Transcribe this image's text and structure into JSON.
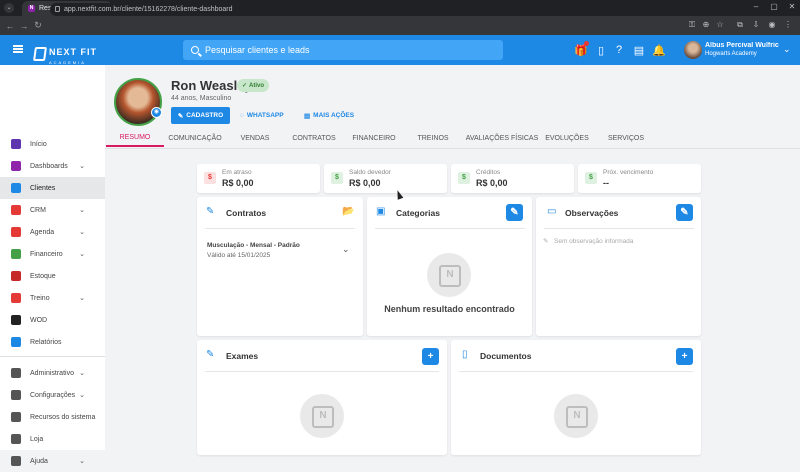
{
  "browser": {
    "tab_title": "Resumo - Next Fit",
    "tab_favicon": "N",
    "url": "app.nextfit.com.br/cliente/15162278/cliente-dashboard"
  },
  "header": {
    "logo_text": "NEXT FIT",
    "logo_sub": "ACADEMIA",
    "search_placeholder": "Pesquisar clientes e leads",
    "user_name": "Albus Percival Wulfric B...",
    "user_org": "Hogwarts Academy",
    "accent": "#1e88e5"
  },
  "sidebar": {
    "items": [
      {
        "label": "Início",
        "icon": "home-icon",
        "color": "#5e35b1"
      },
      {
        "label": "Dashboards",
        "icon": "chart-icon",
        "color": "#8e24aa"
      },
      {
        "label": "Clientes",
        "icon": "people-icon",
        "color": "#1e88e5"
      },
      {
        "label": "CRM",
        "icon": "crm-icon",
        "color": "#e53935"
      },
      {
        "label": "Agenda",
        "icon": "calendar-icon",
        "color": "#e53935"
      },
      {
        "label": "Financeiro",
        "icon": "money-icon",
        "color": "#43a047"
      },
      {
        "label": "Estoque",
        "icon": "cart-icon",
        "color": "#c62828"
      },
      {
        "label": "Treino",
        "icon": "dumbbell-icon",
        "color": "#e53935"
      },
      {
        "label": "WOD",
        "icon": "kettlebell-icon",
        "color": "#222222"
      },
      {
        "label": "Relatórios",
        "icon": "report-icon",
        "color": "#1e88e5"
      },
      {
        "label": "Administrativo",
        "icon": "admin-icon",
        "color": "#555555"
      },
      {
        "label": "Configurações",
        "icon": "gear-icon",
        "color": "#555555"
      },
      {
        "label": "Recursos do sistema",
        "icon": "toggle-icon",
        "color": "#555555"
      },
      {
        "label": "Loja",
        "icon": "shop-icon",
        "color": "#555555"
      },
      {
        "label": "Ajuda",
        "icon": "help-icon",
        "color": "#555555"
      }
    ]
  },
  "profile": {
    "name": "Ron Weasley",
    "status": "Ativo",
    "info": "44 anos, Masculino",
    "btn_cadastro": "CADASTRO",
    "btn_whatsapp": "WHATSAPP",
    "btn_more": "MAIS AÇÕES"
  },
  "tabs": [
    "RESUMO",
    "COMUNICAÇÃO",
    "VENDAS",
    "CONTRATOS",
    "FINANCEIRO",
    "TREINOS",
    "AVALIAÇÕES FÍSICAS",
    "EVOLUÇÕES",
    "SERVIÇOS"
  ],
  "summary": [
    {
      "label": "Em atraso",
      "value": "R$ 0,00",
      "color": "#e53935"
    },
    {
      "label": "Saldo devedor",
      "value": "R$ 0,00",
      "color": "#43a047"
    },
    {
      "label": "Créditos",
      "value": "R$ 0,00",
      "color": "#43a047"
    },
    {
      "label": "Próx. vencimento",
      "value": "--",
      "color": "#43a047"
    }
  ],
  "contratos": {
    "title": "Contratos",
    "plan": "Musculação - Mensal - Padrão",
    "valid": "Válido até 15/01/2025"
  },
  "categorias": {
    "title": "Categorias",
    "empty": "Nenhum resultado encontrado"
  },
  "observacoes": {
    "title": "Observações",
    "empty": "Sem observação informada"
  },
  "exames": {
    "title": "Exames"
  },
  "documentos": {
    "title": "Documentos"
  }
}
